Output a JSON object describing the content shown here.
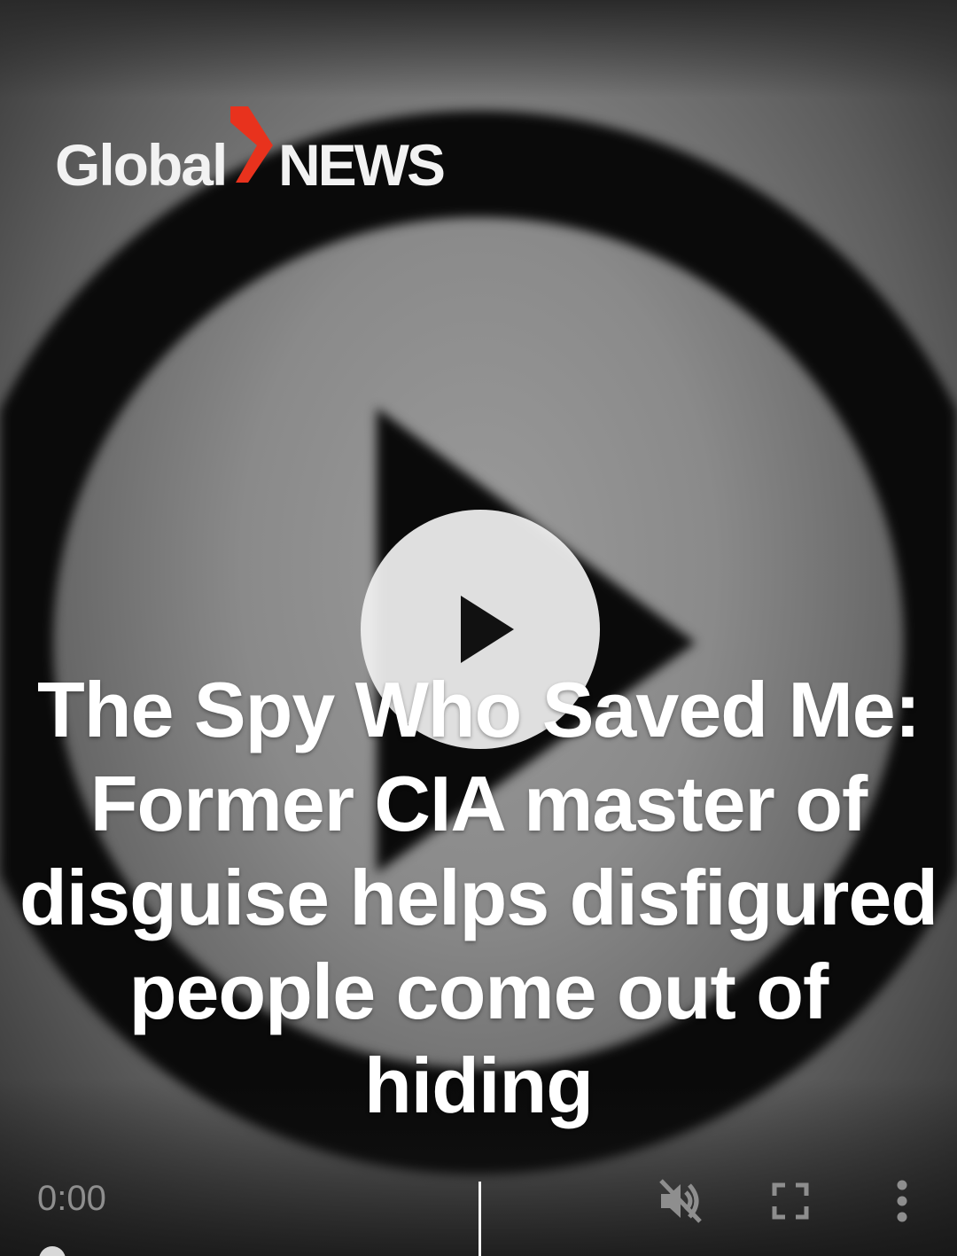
{
  "logo": {
    "brand_word": "Global",
    "news_word": "NEWS",
    "accent_color": "#e8321d"
  },
  "video": {
    "title": "The Spy Who Saved Me: Former CIA master of disguise helps disfigured people come out of hiding",
    "play_icon": "play-icon"
  },
  "controls": {
    "current_time": "0:00",
    "mute_icon": "volume-muted-icon",
    "fullscreen_icon": "fullscreen-icon",
    "more_icon": "more-vertical-icon",
    "progress": 0
  },
  "colors": {
    "controls_inactive": "#8e8e8e",
    "title_text": "#ffffff",
    "play_button_bg": "#f0f0f0"
  }
}
